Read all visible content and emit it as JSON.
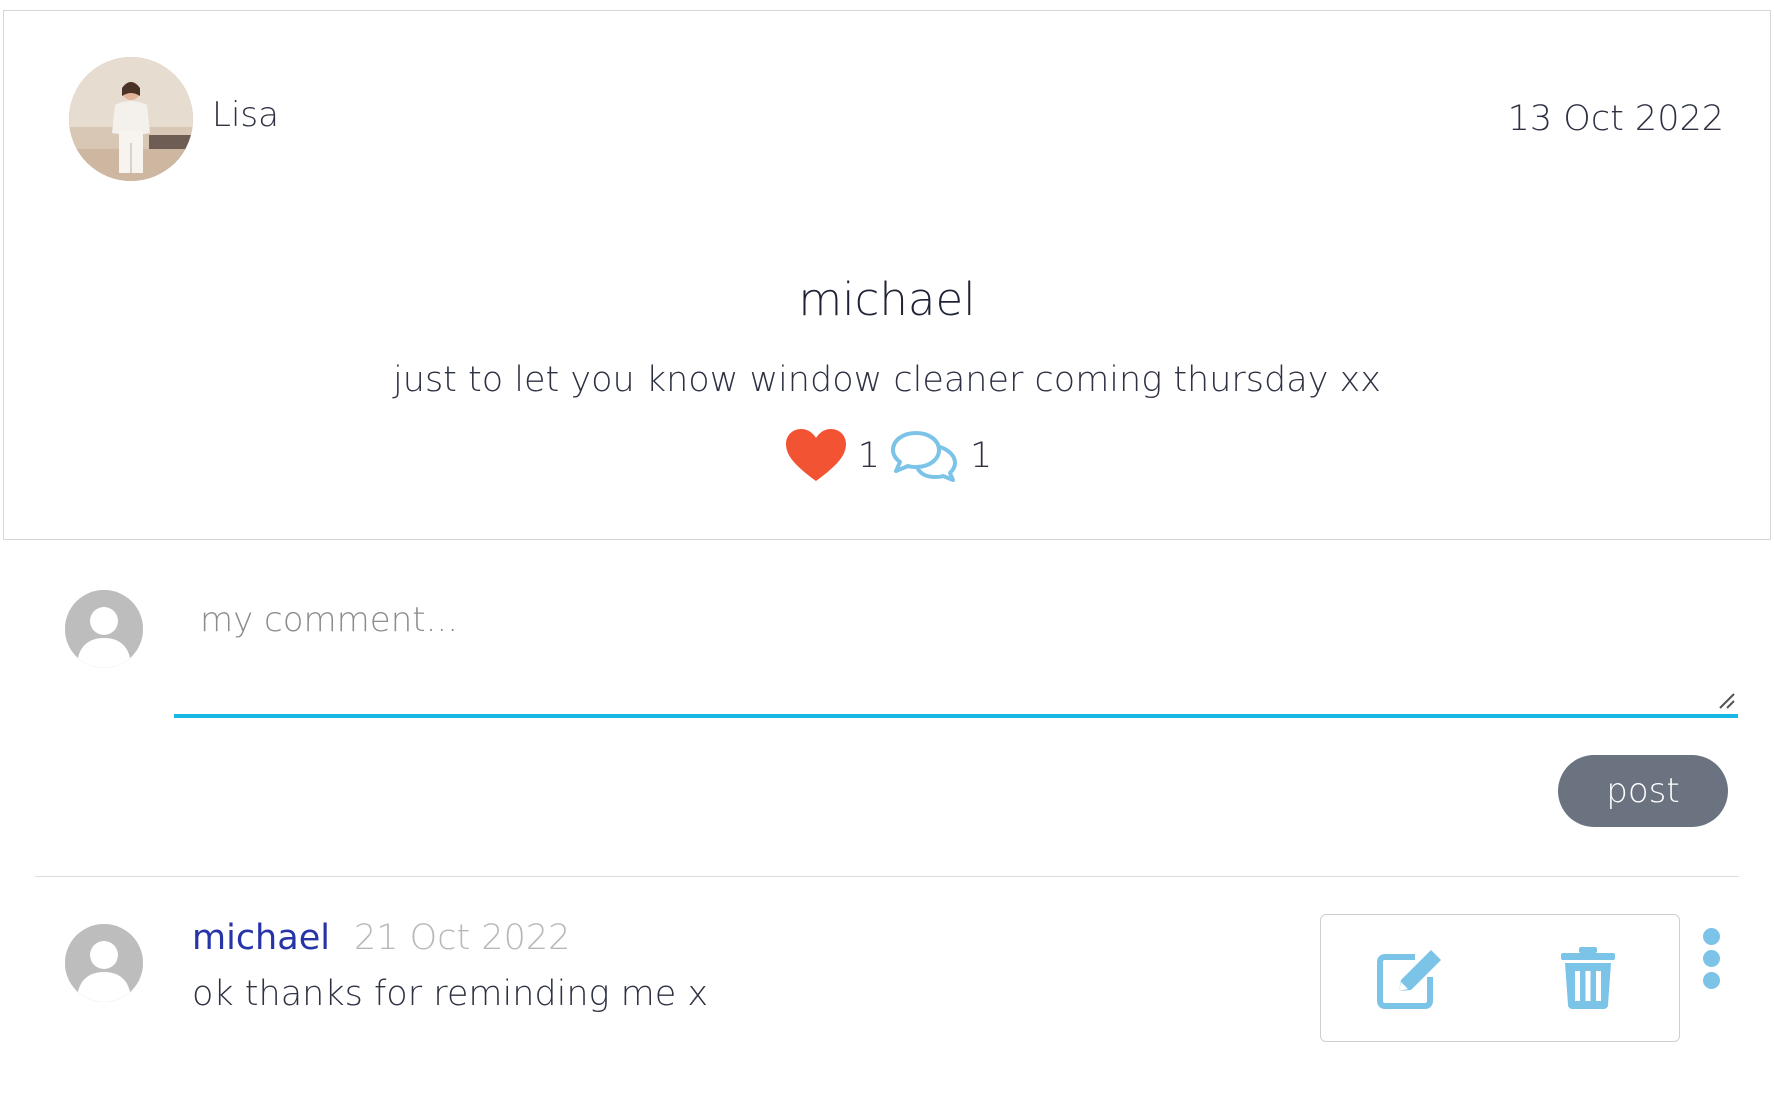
{
  "post": {
    "author": "Lisa",
    "date": "13 Oct 2022",
    "title": "michael",
    "body": "just to let you know window cleaner coming thursday xx",
    "likes": "1",
    "comments_count": "1"
  },
  "comment_form": {
    "placeholder": "my comment...",
    "submit_label": "post"
  },
  "comments": [
    {
      "author": "michael",
      "date": "21 Oct 2022",
      "text": "ok thanks for reminding me x"
    }
  ],
  "colors": {
    "heart": "#f25433",
    "comment_icon": "#7cc3e8",
    "input_underline": "#19b7e6",
    "post_button": "#6b7280",
    "comment_author": "#2634a8"
  },
  "icons": {
    "like": "heart-icon",
    "comment": "speech-bubbles-icon",
    "edit": "edit-icon",
    "delete": "trash-icon",
    "more": "kebab-menu-icon",
    "avatar_placeholder": "default-user-icon"
  }
}
